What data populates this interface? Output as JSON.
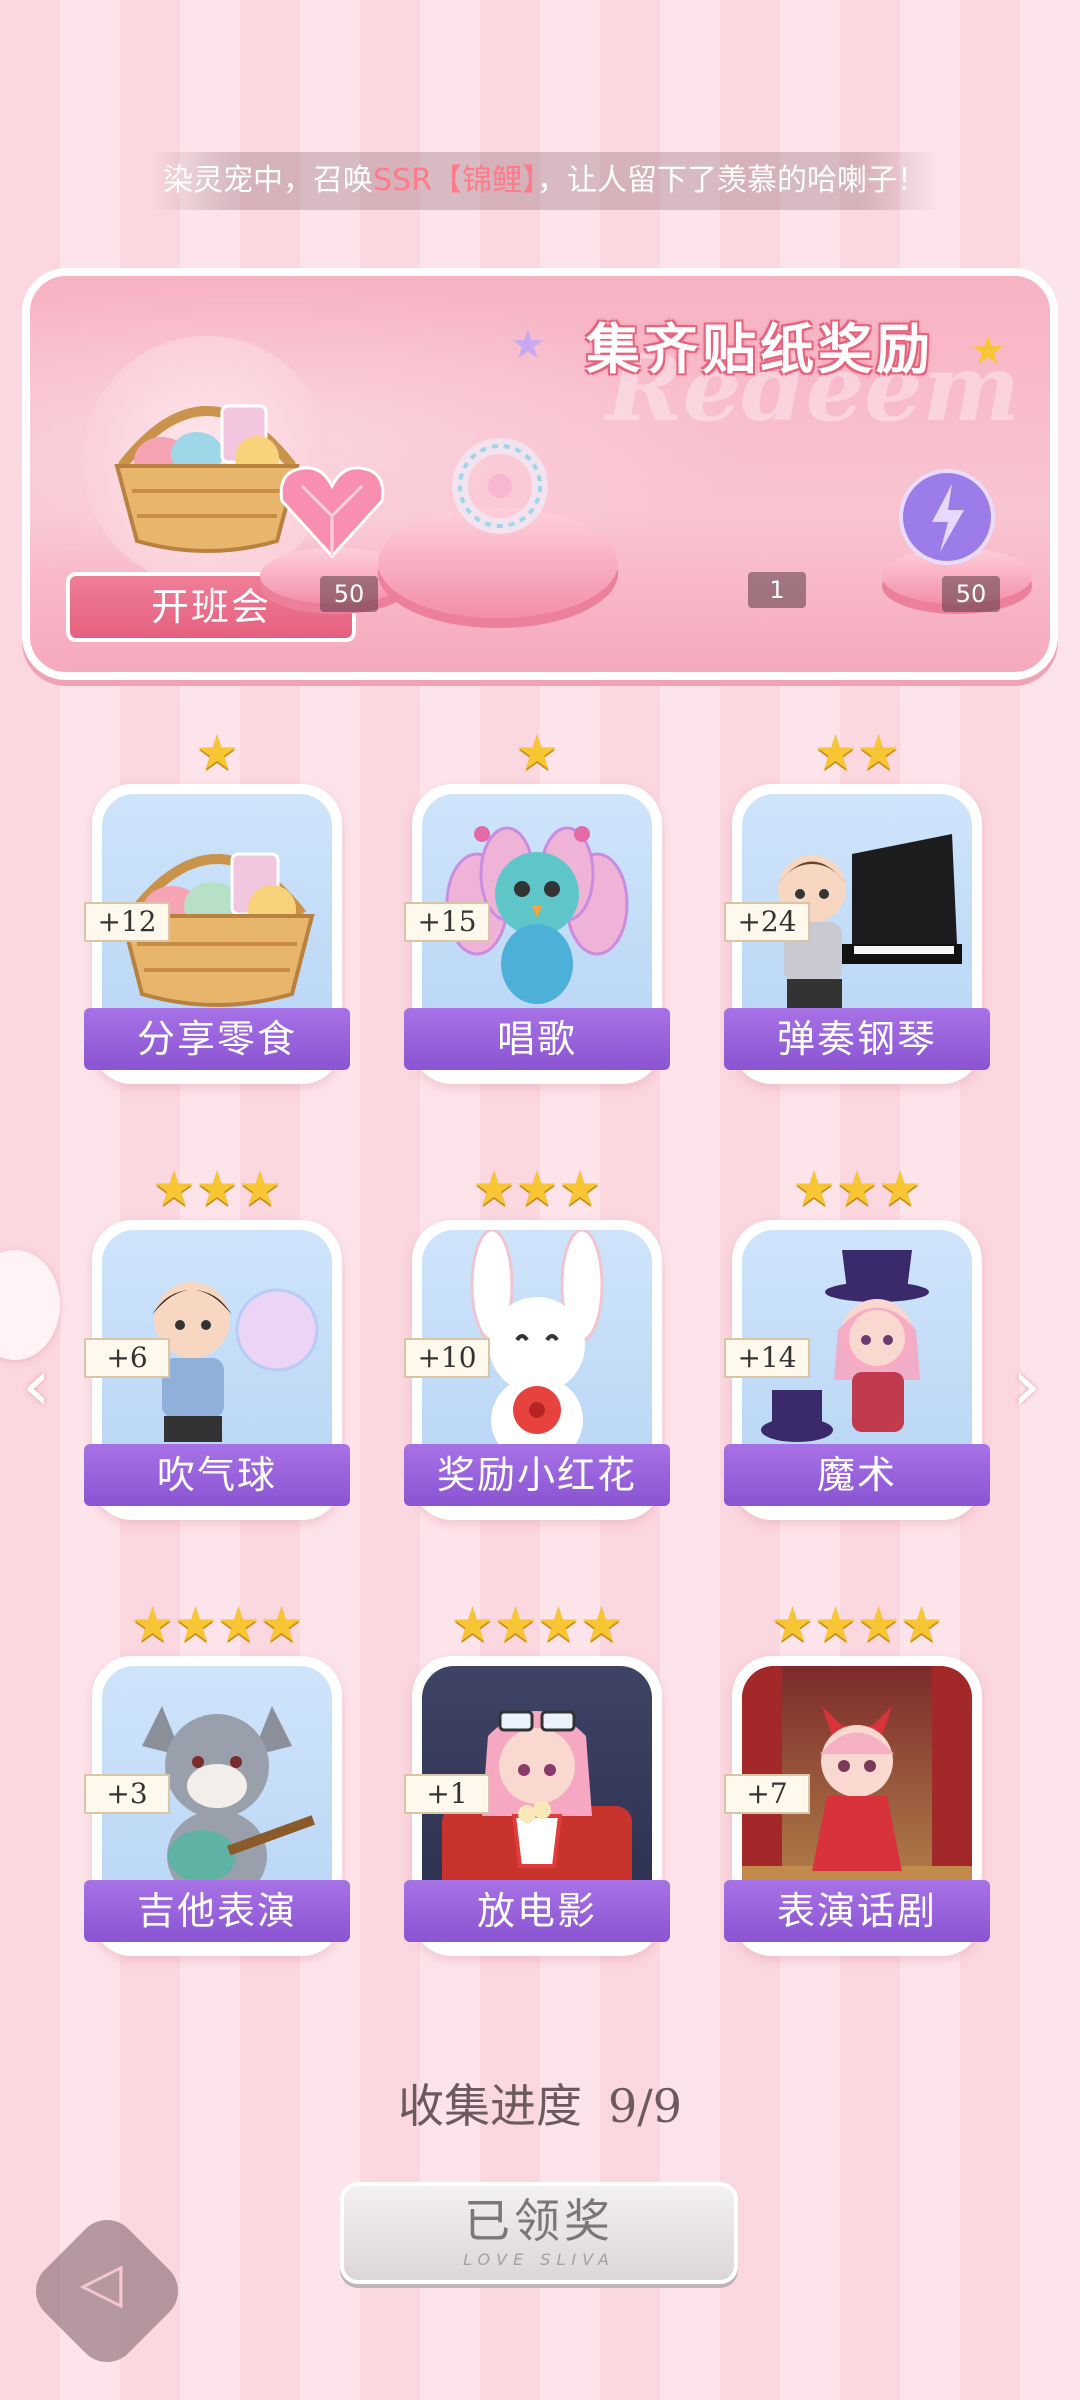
{
  "marquee": {
    "prefix": "染灵宠中，召唤",
    "highlight": "SSR【锦鲤】",
    "suffix": "，让人留下了羡慕的哈喇子！"
  },
  "banner": {
    "title": "集齐贴纸奖励",
    "watermark": "Redeem",
    "event_label": "开班会",
    "rewards": [
      {
        "icon": "pink-heart-gem-icon",
        "qty": "50"
      },
      {
        "icon": "pearl-bracelet-icon",
        "qty": "1"
      },
      {
        "icon": "purple-lightning-orb-icon",
        "qty": "50"
      }
    ]
  },
  "cards": [
    {
      "label": "分享零食",
      "points": "+12",
      "stars": "★",
      "art": "snack-basket"
    },
    {
      "label": "唱歌",
      "points": "+15",
      "stars": "★",
      "art": "singing-peacock"
    },
    {
      "label": "弹奏钢琴",
      "points": "+24",
      "stars": "★★",
      "art": "piano-boy"
    },
    {
      "label": "吹气球",
      "points": "+6",
      "stars": "★★★",
      "art": "bubble-boy"
    },
    {
      "label": "奖励小红花",
      "points": "+10",
      "stars": "★★★",
      "art": "bunny-flower"
    },
    {
      "label": "魔术",
      "points": "+14",
      "stars": "★★★",
      "art": "magician-girl"
    },
    {
      "label": "吉他表演",
      "points": "+3",
      "stars": "★★★★",
      "art": "wolf-guitar"
    },
    {
      "label": "放电影",
      "points": "+1",
      "stars": "★★★★",
      "art": "movie-girl"
    },
    {
      "label": "表演话剧",
      "points": "+7",
      "stars": "★★★★",
      "art": "drama-cat-girl"
    }
  ],
  "progress": {
    "label": "收集进度",
    "value": "9/9"
  },
  "claim_button": {
    "label": "已领奖",
    "sub": "LOVE SLIVA"
  },
  "colors": {
    "ribbon": "#9a62dc",
    "banner": "#f7b3c4",
    "star": "#f8c535"
  }
}
